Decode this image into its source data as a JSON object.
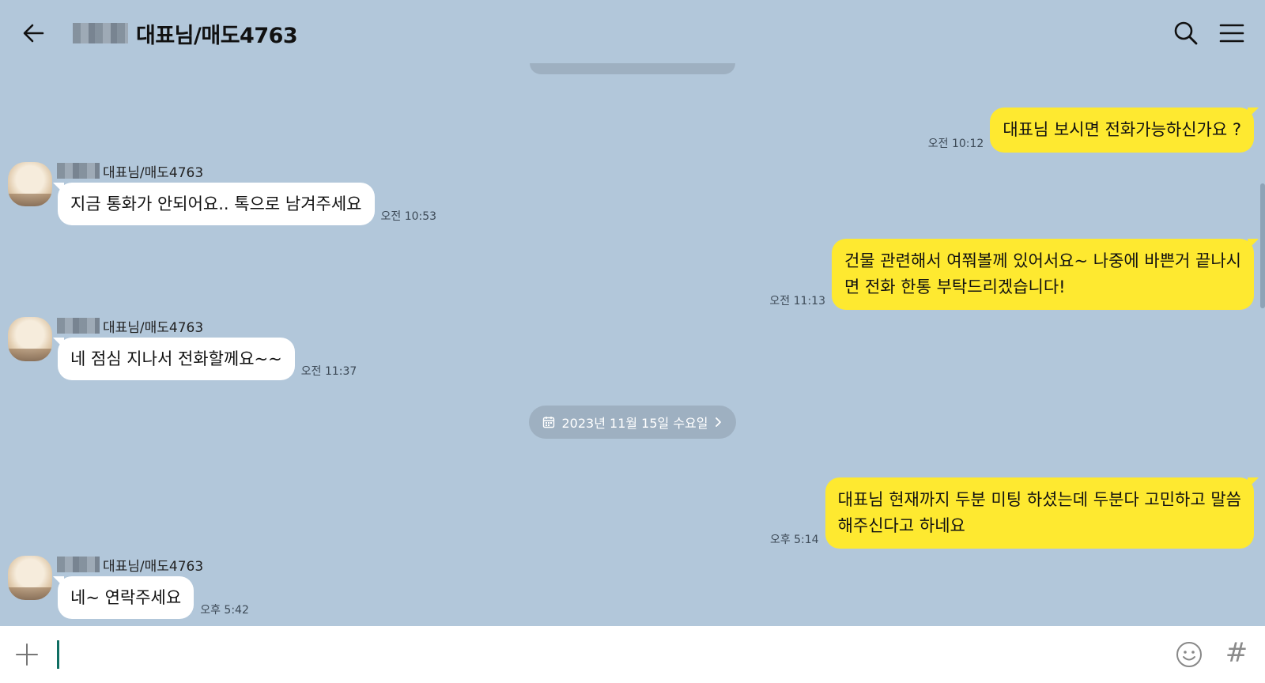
{
  "header": {
    "title": "대표님/매도4763"
  },
  "chat": {
    "messages": [
      {
        "from": "me",
        "text": "대표님 보시면 전화가능하신가요 ?",
        "time": "오전 10:12"
      },
      {
        "from": "other",
        "sender": "대표님/매도4763",
        "text": "지금 통화가 안되어요.. 톡으로 남겨주세요",
        "time": "오전 10:53"
      },
      {
        "from": "me",
        "lines": [
          "건물 관련해서 여쭤볼께 있어서요~ 나중에 바쁜거 끝나시",
          "면 전화 한통 부탁드리겠습니다!"
        ],
        "time": "오전 11:13"
      },
      {
        "from": "other",
        "sender": "대표님/매도4763",
        "text": "네 점심 지나서 전화할께요~~",
        "time": "오전 11:37"
      },
      {
        "from": "me",
        "lines": [
          "대표님 현재까지 두분 미팅 하셨는데 두분다 고민하고 말씀",
          "해주신다고 하네요"
        ],
        "time": "오후 5:14"
      },
      {
        "from": "other",
        "sender": "대표님/매도4763",
        "text": "네~ 연락주세요",
        "time": "오후 5:42"
      }
    ],
    "date_divider": "2023년 11월 15일 수요일"
  },
  "input": {
    "value": "",
    "hash_label": "#"
  },
  "icons": {
    "back": "arrow-left-icon",
    "search": "search-icon",
    "menu": "hamburger-icon",
    "plus": "plus-icon",
    "emoji": "emoji-icon",
    "calendar": "calendar-icon",
    "chevron": "chevron-right-icon"
  },
  "colors": {
    "background": "#b2c7da",
    "my_bubble": "#fee930",
    "other_bubble": "#ffffff",
    "pill": "#9eb0c1"
  }
}
